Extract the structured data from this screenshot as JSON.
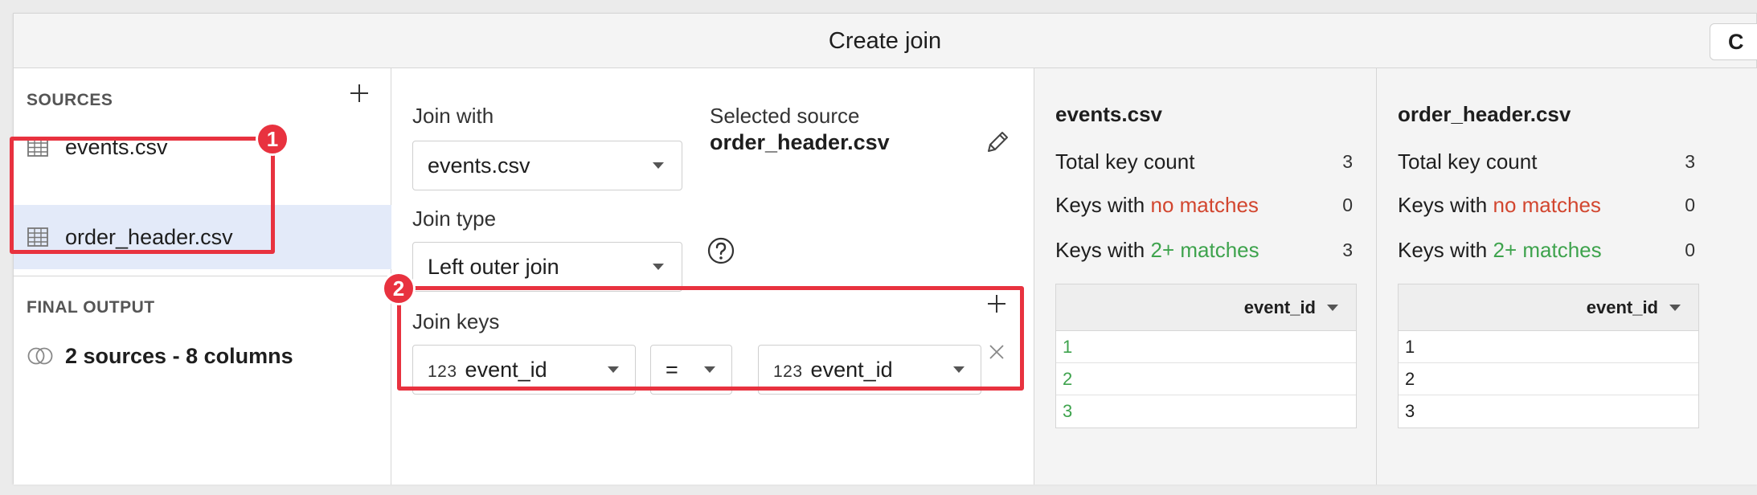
{
  "dialog": {
    "title": "Create join",
    "header_button_label": "C"
  },
  "sources": {
    "heading": "SOURCES",
    "add_icon": "plus-icon",
    "items": [
      {
        "label": "events.csv",
        "icon": "table-icon",
        "selected": false
      },
      {
        "label": "order_header.csv",
        "icon": "table-icon",
        "selected": true
      }
    ],
    "final_output_heading": "FINAL OUTPUT",
    "final_output_label": "2 sources - 8 columns",
    "final_output_icon": "join-circles-icon"
  },
  "config": {
    "join_with_label": "Join with",
    "join_with_value": "events.csv",
    "selected_source_label": "Selected source",
    "selected_source_value": "order_header.csv",
    "join_type_label": "Join type",
    "join_type_value": "Left outer join",
    "join_keys_label": "Join keys",
    "key_left": {
      "type": "123",
      "value": "event_id"
    },
    "operator": "=",
    "key_right": {
      "type": "123",
      "value": "event_id"
    }
  },
  "stats": [
    {
      "title": "events.csv",
      "total_label": "Total key count",
      "total_value": "3",
      "no_match_prefix": "Keys with",
      "no_match_highlight": "no matches",
      "no_match_value": "0",
      "multi_prefix": "Keys with",
      "multi_highlight": "2+ matches",
      "multi_value": "3",
      "column_header": "event_id",
      "rows": [
        "1",
        "2",
        "3"
      ],
      "rows_color": "#3ea34d"
    },
    {
      "title": "order_header.csv",
      "total_label": "Total key count",
      "total_value": "3",
      "no_match_prefix": "Keys with",
      "no_match_highlight": "no matches",
      "no_match_value": "0",
      "multi_prefix": "Keys with",
      "multi_highlight": "2+ matches",
      "multi_value": "0",
      "column_header": "event_id",
      "rows": [
        "1",
        "2",
        "3"
      ],
      "rows_color": "#1e1e1e"
    }
  ],
  "callouts": [
    {
      "number": "1"
    },
    {
      "number": "2"
    }
  ],
  "colors": {
    "accent_red": "#e8323f",
    "no_match_red": "#d2462f",
    "match_green": "#3ea34d",
    "selected_bg": "#e3eaf9"
  }
}
